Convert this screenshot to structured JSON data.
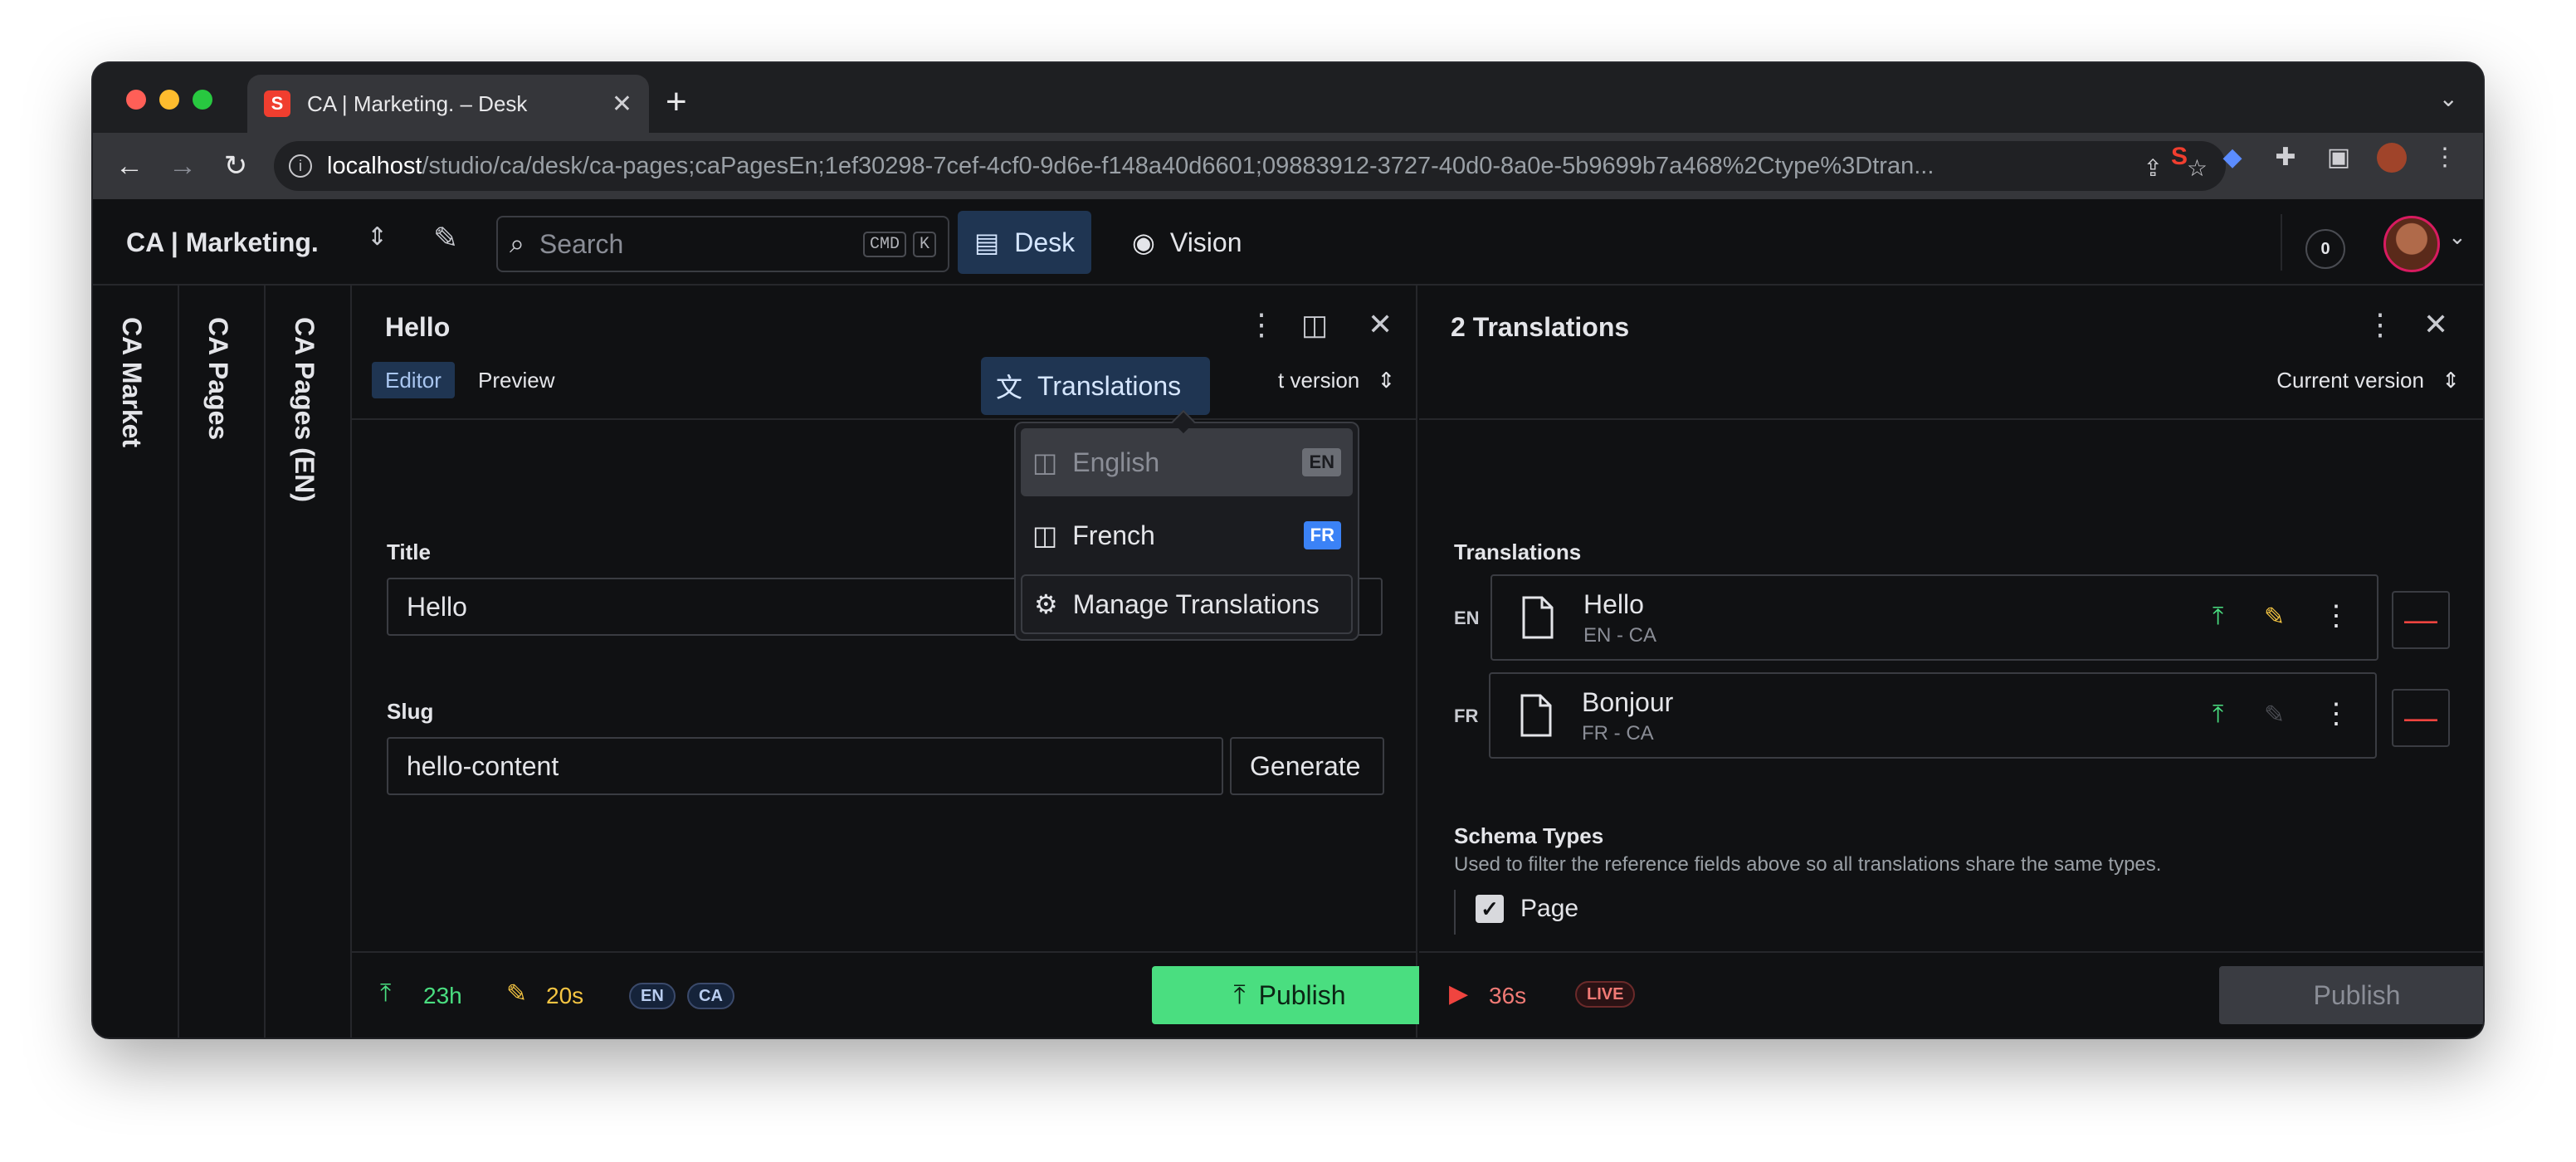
{
  "browser": {
    "tab_title": "CA | Marketing. – Desk",
    "favicon": "S",
    "url_host": "localhost",
    "url_path": "/studio/ca/desk/ca-pages;caPagesEn;1ef30298-7cef-4cf0-9d6e-f148a40d6601;09883912-3727-40d0-8a0e-5b9699b7a468%2Ctype%3Dtran..."
  },
  "studio": {
    "brand": "CA | Marketing.",
    "search_placeholder": "Search",
    "kbd_cmd": "CMD",
    "kbd_k": "K",
    "desk_label": "Desk",
    "vision_label": "Vision",
    "notifications": "0"
  },
  "side_panes": [
    "CA Market",
    "CA Pages",
    "CA Pages (EN)"
  ],
  "editor": {
    "title": "Hello",
    "tabs": [
      "Editor",
      "Preview"
    ],
    "version_label_partial": "t version",
    "translations_button": "Translations",
    "fields": {
      "title_label": "Title",
      "title_value": "Hello",
      "slug_label": "Slug",
      "slug_value": "hello-content",
      "generate_label": "Generate"
    },
    "footer": {
      "published_ago": "23h",
      "edited_ago": "20s",
      "badges": [
        "EN",
        "CA"
      ],
      "publish_label": "Publish"
    }
  },
  "translations_menu": {
    "items": [
      {
        "label": "English",
        "tag": "EN"
      },
      {
        "label": "French",
        "tag": "FR"
      }
    ],
    "manage_label": "Manage Translations"
  },
  "right_pane": {
    "title": "2 Translations",
    "version_label": "Current version",
    "section_label": "Translations",
    "translations": [
      {
        "lang": "EN",
        "title": "Hello",
        "sub": "EN - CA"
      },
      {
        "lang": "FR",
        "title": "Bonjour",
        "sub": "FR - CA"
      }
    ],
    "schema_label": "Schema Types",
    "schema_desc": "Used to filter the reference fields above so all translations share the same types.",
    "schema_option": "Page",
    "footer": {
      "time": "36s",
      "live_label": "LIVE",
      "publish_label": "Publish"
    }
  },
  "colors": {
    "accent_green": "#4ade80",
    "accent_blue": "#1f3552",
    "edit_yellow": "#f5c542",
    "danger_red": "#f0443f"
  }
}
